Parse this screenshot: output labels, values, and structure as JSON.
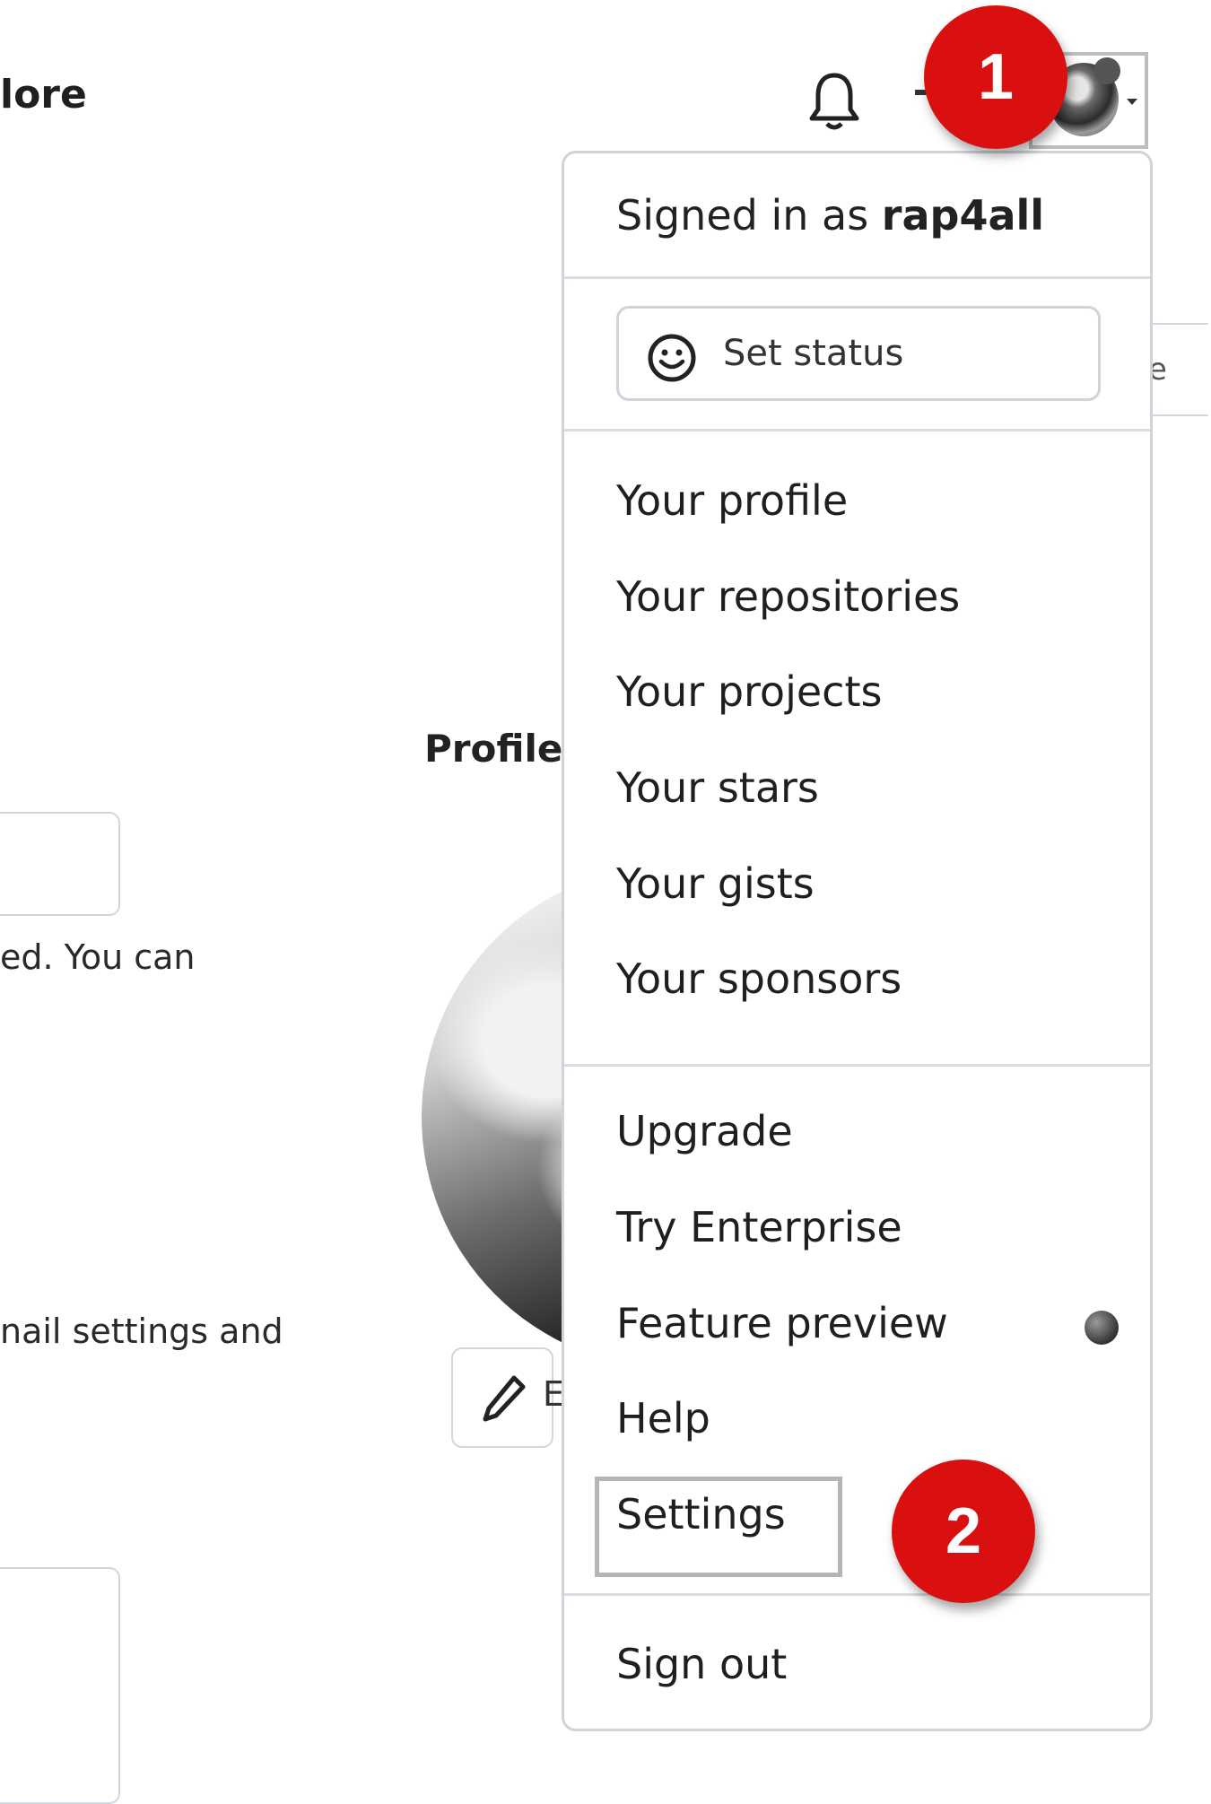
{
  "header": {
    "explore_fragment": "lore"
  },
  "side_button_fragment": "e",
  "profile_section": {
    "heading_fragment": "Profile",
    "text_fragment_1": "ed. You can",
    "text_fragment_2": "nail settings and",
    "edit_fragment": "E"
  },
  "menu": {
    "signed_in_prefix": "Signed in as",
    "username": "rap4all",
    "set_status": "Set status",
    "items_group1": [
      "Your profile",
      "Your repositories",
      "Your projects",
      "Your stars",
      "Your gists",
      "Your sponsors"
    ],
    "items_group2": [
      "Upgrade",
      "Try Enterprise",
      "Feature preview",
      "Help",
      "Settings"
    ],
    "sign_out": "Sign out"
  },
  "markers": [
    "1",
    "2"
  ],
  "colors": {
    "marker": "#d9100f",
    "border": "#cfd4da"
  }
}
